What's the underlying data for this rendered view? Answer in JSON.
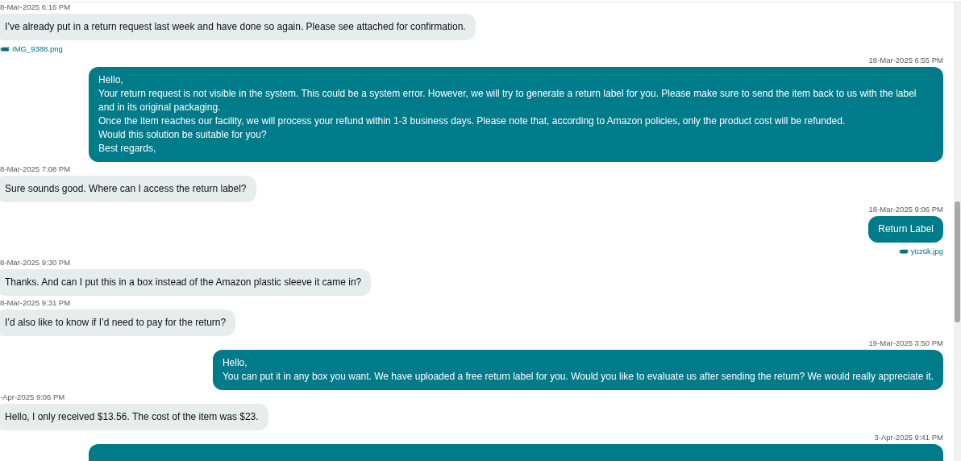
{
  "messages": [
    {
      "kind": "customer",
      "timestamp": "8-Mar-2025 6:16 PM",
      "paragraphs": [
        "I’ve already put in a return request last week and have done so again. Please see attached for confirmation."
      ],
      "attachment": "IMG_9388.png"
    },
    {
      "kind": "agent",
      "timestamp": "18-Mar-2025 6:55 PM",
      "paragraphs": [
        "Hello,",
        "Your return request is not visible in the system. This could be a system error. However, we will try to generate a return label for you. Please make sure to send the item back to us with the label and in its original packaging.",
        "Once the item reaches our facility, we will process your refund within 1-3 business days. Please note that, according to Amazon policies, only the product cost will be refunded.",
        "Would this solution be suitable for you?",
        "Best regards,"
      ]
    },
    {
      "kind": "customer",
      "timestamp": "8-Mar-2025 7:08 PM",
      "paragraphs": [
        "Sure sounds good. Where can I access the return label?"
      ]
    },
    {
      "kind": "agent",
      "timestamp": "18-Mar-2025 9:06 PM",
      "paragraphs": [
        "Return Label"
      ],
      "attachment": "yüzük.jpg"
    },
    {
      "kind": "customer",
      "timestamp": "8-Mar-2025 9:30 PM",
      "paragraphs": [
        "Thanks. And can I put this in a box instead of the Amazon plastic sleeve it came in?"
      ]
    },
    {
      "kind": "customer",
      "timestamp": "8-Mar-2025 9:31 PM",
      "paragraphs": [
        "I’d also like to know if I’d need to pay for the return?"
      ]
    },
    {
      "kind": "agent",
      "timestamp": "19-Mar-2025 3:50 PM",
      "paragraphs": [
        "Hello,",
        "You can put it in any box you want. We have uploaded a free return label for you. Would you like to evaluate us after sending the return? We would really appreciate it."
      ]
    },
    {
      "kind": "customer",
      "timestamp": "-Apr-2025 9:06 PM",
      "paragraphs": [
        "Hello, I only received $13.56. The cost of the item was $23."
      ]
    },
    {
      "kind": "agent",
      "timestamp": "3-Apr-2025 9:41 PM"
    }
  ]
}
